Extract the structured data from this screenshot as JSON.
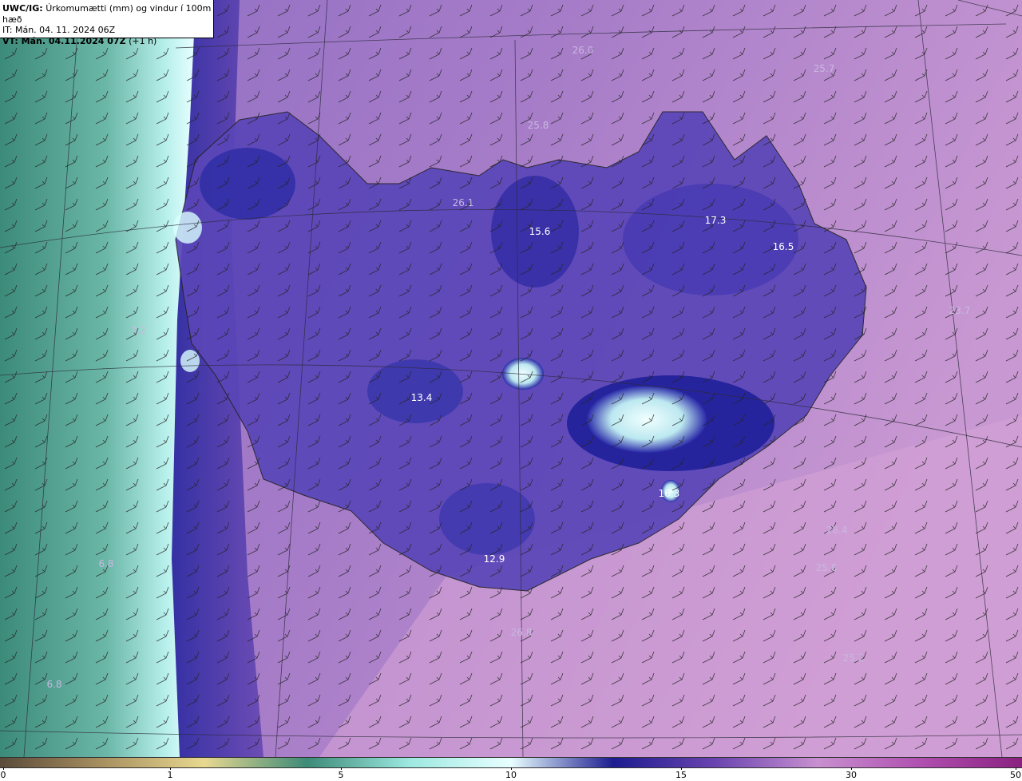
{
  "header": {
    "line1_bold": "UWC/IG:",
    "line1_rest": "Úrkomumætti (mm) og vindur í 100m hæð",
    "line2": "IT: Mán. 04. 11. 2024 06Z",
    "line3_bold": "VT: Mán. 04.11.2024 07Z",
    "line3_rest": "(+1 h)"
  },
  "map_labels": [
    {
      "text": "26.0",
      "tone": "light"
    },
    {
      "text": "25.7",
      "tone": "light"
    },
    {
      "text": "25.8",
      "tone": "light"
    },
    {
      "text": "26.1",
      "tone": "light"
    },
    {
      "text": "15.6",
      "tone": "white"
    },
    {
      "text": "17.3",
      "tone": "white"
    },
    {
      "text": "16.5",
      "tone": "white"
    },
    {
      "text": "23.7",
      "tone": "light"
    },
    {
      "text": "7.2",
      "tone": "light"
    },
    {
      "text": "13.4",
      "tone": "white"
    },
    {
      "text": "16.3",
      "tone": "white"
    },
    {
      "text": "26.4",
      "tone": "light"
    },
    {
      "text": "25.8",
      "tone": "light"
    },
    {
      "text": "6.8",
      "tone": "light"
    },
    {
      "text": "12.9",
      "tone": "white"
    },
    {
      "text": "26.8",
      "tone": "light"
    },
    {
      "text": "25.2",
      "tone": "light"
    },
    {
      "text": "6.8",
      "tone": "light"
    }
  ],
  "colorbar": {
    "ticks": [
      "0",
      "1",
      "5",
      "10",
      "15",
      "30",
      "50"
    ],
    "colors": [
      "#5a4a3a",
      "#a89060",
      "#e8d890",
      "#3c8a78",
      "#9ce8e0",
      "#e8ffff",
      "#1c1c90",
      "#6a44b0",
      "#c890d0",
      "#b050b0",
      "#8a2080"
    ]
  }
}
